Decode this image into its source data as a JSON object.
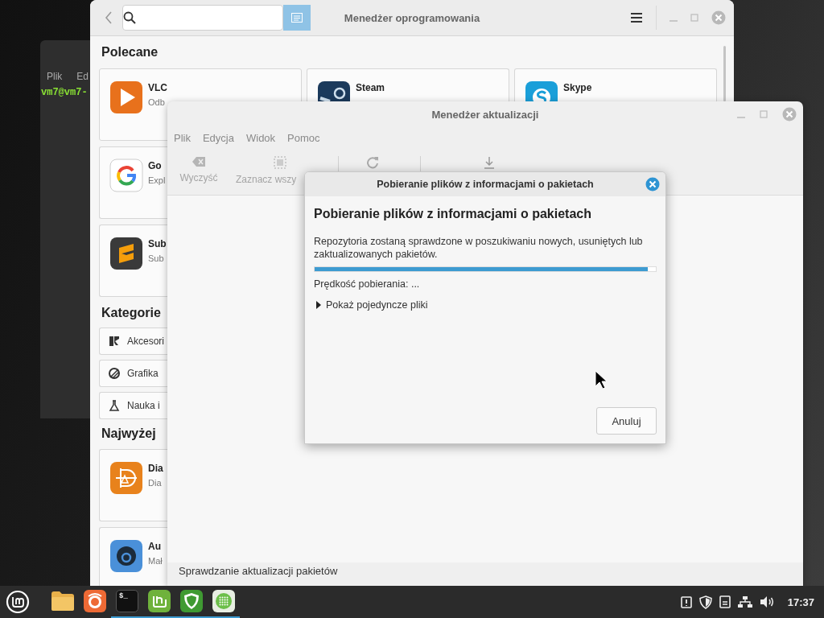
{
  "terminal": {
    "menu": [
      "Plik",
      "Ed"
    ],
    "prompt": "vm7@vm7-"
  },
  "software_manager": {
    "title": "Menedżer oprogramowania",
    "featured": {
      "heading": "Polecane",
      "apps": [
        {
          "name": "VLC",
          "description": "Odb",
          "kind": "play"
        },
        {
          "name": "Steam",
          "kind": "steam"
        },
        {
          "name": "Skype",
          "kind": "skype"
        },
        {
          "name": "Go",
          "description": "Expl",
          "kind": "google"
        },
        {
          "name": "Sub",
          "description": "Sub",
          "kind": "sublime"
        }
      ]
    },
    "categories": {
      "heading": "Kategorie",
      "items": [
        {
          "label": "Akcesori",
          "kind": "accessories"
        },
        {
          "label": "Grafika",
          "kind": "graphics"
        },
        {
          "label": "Nauka i",
          "kind": "science"
        }
      ]
    },
    "top_rated": {
      "heading": "Najwyżej",
      "apps": [
        {
          "name": "Dia",
          "description": "Dia",
          "kind": "diagram"
        },
        {
          "name": "Au",
          "description": "Mał",
          "kind": "audio"
        }
      ]
    }
  },
  "update_manager": {
    "title": "Menedżer aktualizacji",
    "menu": [
      "Plik",
      "Edycja",
      "Widok",
      "Pomoc"
    ],
    "toolbar": [
      {
        "kind": "clear",
        "label": "Wyczyść"
      },
      {
        "kind": "select_all",
        "label": "Zaznacz wszy"
      },
      {
        "kind": "refresh"
      },
      {
        "kind": "install"
      }
    ],
    "status": "Sprawdzanie aktualizacji pakietów"
  },
  "dialog": {
    "title": "Pobieranie plików z informacjami o pakietach",
    "heading": "Pobieranie plików z informacjami o pakietach",
    "description": "Repozytoria zostaną sprawdzone w poszukiwaniu nowych, usuniętych lub zaktualizowanych pakietów.",
    "progress": {
      "level": 0.976
    },
    "speed": "Prędkość pobierania: ...",
    "expander": {
      "label": "Pokaż pojedyncze pliki",
      "expanded": false
    },
    "buttons": [
      "Anuluj"
    ]
  },
  "taskbar": {
    "launchers": [
      {
        "kind": "files",
        "running": false
      },
      {
        "kind": "browser",
        "running": false
      },
      {
        "kind": "terminal",
        "label": "$_",
        "running": true
      },
      {
        "kind": "update",
        "running": true
      },
      {
        "kind": "shield",
        "running": true
      },
      {
        "kind": "apps",
        "running": true
      }
    ],
    "clock": "17:37"
  }
}
